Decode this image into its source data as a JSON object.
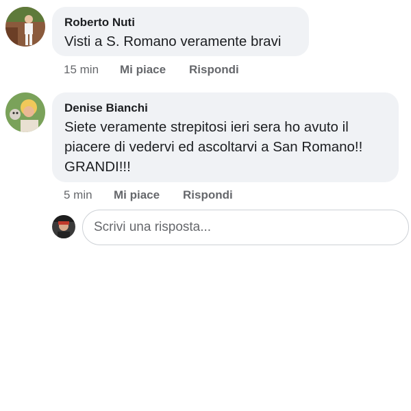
{
  "comments": [
    {
      "author": "Roberto Nuti",
      "text_lines": [
        "Visti a S. Romano veramente bravi"
      ],
      "time": "15 min",
      "like_label": "Mi piace",
      "reply_label": "Rispondi"
    },
    {
      "author": "Denise Bianchi",
      "text_lines": [
        "Siete veramente strepitosi ieri sera ho avuto il",
        "piacere di vedervi ed ascoltarvi a San Romano!!",
        "GRANDI!!!"
      ],
      "time": "5 min",
      "like_label": "Mi piace",
      "reply_label": "Rispondi"
    }
  ],
  "reply_box": {
    "placeholder": "Scrivi una risposta..."
  },
  "colors": {
    "bubble": "#f0f2f5",
    "text": "#1c1e21",
    "meta": "#65676b",
    "border": "#ccd0d5"
  }
}
